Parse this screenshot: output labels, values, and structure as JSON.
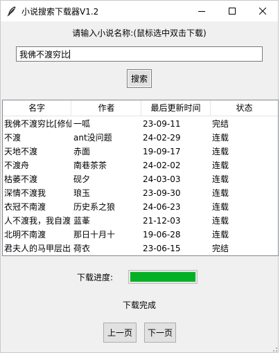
{
  "window": {
    "title": "小说搜索下载器V1.2",
    "icon": "feather-icon"
  },
  "colors": {
    "progress_fill": "#06b025",
    "window_bg": "#f0f0f0"
  },
  "search": {
    "prompt": "请输入小说名称:(鼠标选中双击下载)",
    "value": "我佛不渡穷比",
    "button_label": "搜索"
  },
  "table": {
    "headers": [
      "名字",
      "作者",
      "最后更新时间",
      "状态"
    ],
    "rows": [
      [
        "我佛不渡穷比[修仙]",
        "一呱",
        "23-09-11",
        "完结"
      ],
      [
        "不渡",
        "ant没问题",
        "24-02-29",
        "连载"
      ],
      [
        "天地不渡",
        "赤面",
        "19-09-17",
        "连载"
      ],
      [
        "不渡舟",
        "南巷茶茶",
        "24-02-02",
        "连载"
      ],
      [
        "枯萎不渡",
        "砚夕",
        "24-03-03",
        "连载"
      ],
      [
        "深情不渡我",
        "琅玉",
        "23-09-30",
        "连载"
      ],
      [
        "衣冠不南渡",
        "历史系之狼",
        "24-06-23",
        "连载"
      ],
      [
        "人不渡我，我自渡",
        "蓝莑",
        "21-12-03",
        "连载"
      ],
      [
        "北明不南渡",
        "那日十月十",
        "19-06-28",
        "连载"
      ],
      [
        "君夫人的马甲层出不穷",
        "荷衣",
        "23-06-15",
        "完结"
      ]
    ]
  },
  "download": {
    "progress_label": "下载进度:",
    "progress_fraction": 1.0,
    "status": "下载完成"
  },
  "pager": {
    "prev_label": "上一页",
    "next_label": "下一页"
  }
}
